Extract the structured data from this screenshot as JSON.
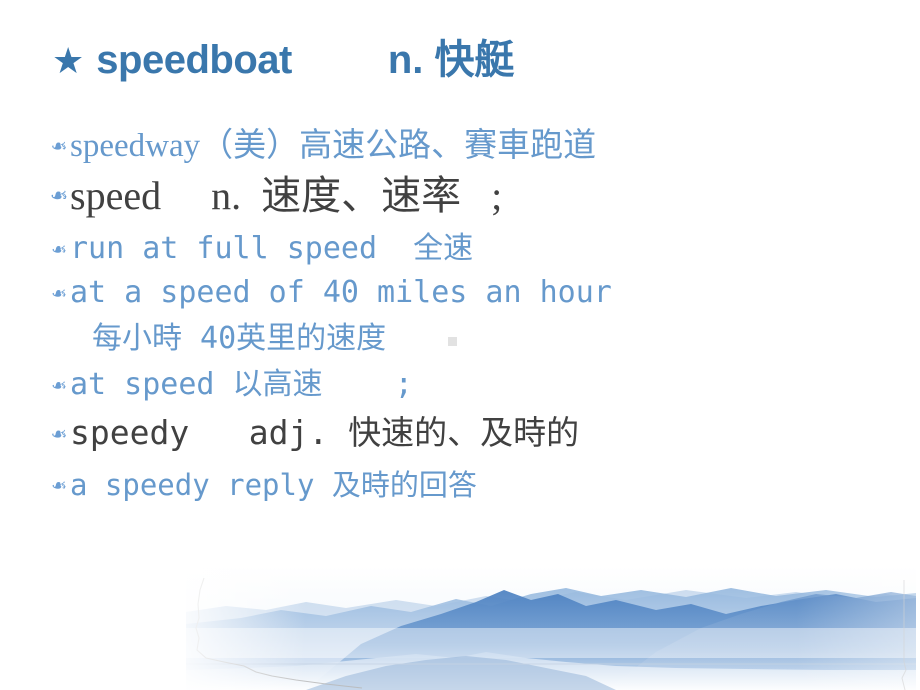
{
  "slide": {
    "title": {
      "star_icon": "★",
      "word": "speedboat",
      "pos_and_meaning": "n. 快艇"
    },
    "bullet_glyph": "❧",
    "lines": [
      {
        "id": "line0",
        "bullet": true,
        "text": "speedway（美）高速公路、賽車跑道",
        "color": "#6699cc",
        "style": "serif"
      },
      {
        "id": "line1",
        "bullet": true,
        "text": "speed     n.  速度、速率   ;",
        "color": "#414141",
        "style": "serif"
      },
      {
        "id": "line2",
        "bullet": true,
        "text": "run at full speed  全速",
        "color": "#6699cc",
        "style": "mono"
      },
      {
        "id": "line3",
        "bullet": true,
        "text": "at a speed of 40 miles an hour",
        "color": "#6699cc",
        "style": "mono"
      },
      {
        "id": "line4",
        "bullet": false,
        "text": "每小時 40英里的速度",
        "color": "#6699cc",
        "style": "mono"
      },
      {
        "id": "line5",
        "bullet": true,
        "text": "at speed 以高速    ;",
        "color": "#6699cc",
        "style": "mono"
      },
      {
        "id": "line6",
        "bullet": true,
        "text": "speedy   adj. 快速的、及時的",
        "color": "#414141",
        "style": "mono"
      },
      {
        "id": "line7",
        "bullet": true,
        "text": "a speedy reply 及時的回答",
        "color": "#6699cc",
        "style": "mono"
      }
    ],
    "picture": {
      "name": "misty-blue-mountain-range",
      "colors": {
        "sky": "#ffffff",
        "haze": "#eaf1f9",
        "far_ridge": "#c3d6ec",
        "mid_ridge": "#8fb4dc",
        "near_ridge": "#5a8ec9",
        "dark_ridge": "#4a7fc0",
        "water": "#dfe9f5",
        "outline": "#b9b9b9"
      }
    },
    "colors": {
      "title_blue": "#3a77ac",
      "body_blue": "#6699cc",
      "body_dark": "#414141",
      "background": "#ffffff",
      "artifact_gray": "#e2e2e2"
    }
  }
}
